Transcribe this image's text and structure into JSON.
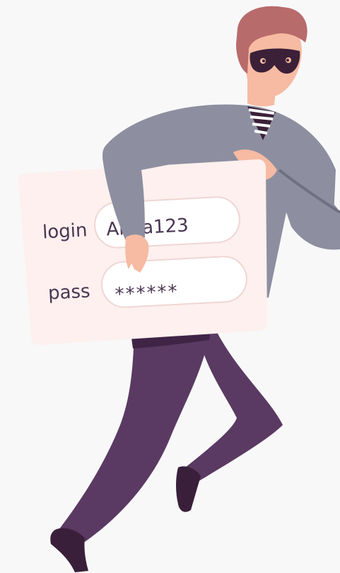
{
  "card": {
    "login_label": "login",
    "login_value": "Anna123",
    "pass_label": "pass",
    "pass_value": "******"
  },
  "colors": {
    "background": "#f8f8f9",
    "card": "#fdf0ee",
    "field": "#ffffff",
    "field_border": "#efd6d3",
    "text": "#4a3552",
    "hair": "#b86b6b",
    "skin": "#f6bba2",
    "mask": "#3b2038",
    "sweater": "#8d8fa0",
    "sweater_dark": "#6f7183",
    "pants": "#5a3a62",
    "pants_dark": "#3f2446",
    "shoe": "#3a1f3a"
  },
  "icons": {
    "figure": "thief-illustration"
  }
}
